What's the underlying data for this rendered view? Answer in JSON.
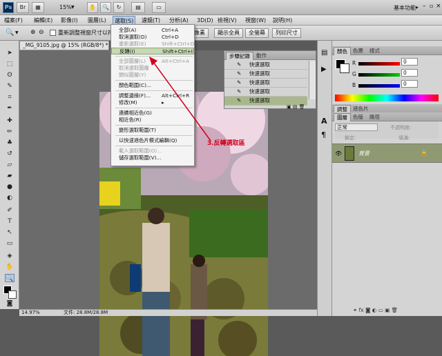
{
  "app": {
    "logo": "Ps",
    "zoom": "15%",
    "workspace_label": "基本功能"
  },
  "menubar": [
    "檔案(F)",
    "編輯(E)",
    "影像(I)",
    "圖層(L)",
    "選取(S)",
    "濾鏡(T)",
    "分析(A)",
    "3D(D)",
    "檢視(V)",
    "視窗(W)",
    "說明(H)"
  ],
  "options": {
    "resize_checkbox": "重新調整視窗尺寸以符",
    "btn_fit": "像素",
    "btn_fill": "顯示全頁",
    "btn_full": "全螢幕",
    "btn_print": "列印尺寸"
  },
  "document": {
    "tab_title": "_MG_9105.jpg @ 15% (RGB/8*) *",
    "status_zoom": "14.97%",
    "status_file": "文件: 28.8M/28.8M"
  },
  "history": {
    "tabs": [
      "步驟記錄",
      "動作"
    ],
    "items": [
      "快速選取",
      "快速選取",
      "快速選取",
      "快速選取",
      "快速選取"
    ]
  },
  "color_panel": {
    "tabs": [
      "顏色",
      "色票",
      "樣式"
    ],
    "channels": [
      {
        "label": "R",
        "value": "0",
        "color": "#ff0000"
      },
      {
        "label": "G",
        "value": "0",
        "color": "#00cc00"
      },
      {
        "label": "B",
        "value": "0",
        "color": "#0000ff"
      }
    ]
  },
  "adjust_panel": {
    "tabs": [
      "調整",
      "遮色片"
    ]
  },
  "layers_panel": {
    "tabs": [
      "圖層",
      "色版",
      "路徑"
    ],
    "blend_mode": "正常",
    "opacity_label": "不透明度:",
    "fill_label": "填滿:",
    "lock_label": "鎖定:",
    "layer_name": "背景"
  },
  "select_menu": {
    "items": [
      {
        "label": "全部(A)",
        "shortcut": "Ctrl+A",
        "state": "normal"
      },
      {
        "label": "取消選取(D)",
        "shortcut": "Ctrl+D",
        "state": "normal"
      },
      {
        "label": "重新選取(E)",
        "shortcut": "Shift+Ctrl+D",
        "state": "disabled"
      },
      {
        "label": "反轉(I)",
        "shortcut": "Shift+Ctrl+I",
        "state": "highlight"
      },
      {
        "sep": true
      },
      {
        "label": "全部圖層(L)",
        "shortcut": "Alt+Ctrl+A",
        "state": "disabled"
      },
      {
        "label": "取消選取圖層",
        "shortcut": "",
        "state": "disabled"
      },
      {
        "label": "類似圖層(Y)",
        "shortcut": "",
        "state": "disabled"
      },
      {
        "sep": true
      },
      {
        "label": "顏色範圍(C)...",
        "shortcut": "",
        "state": "normal"
      },
      {
        "sep": true
      },
      {
        "label": "調整邊緣(F)...",
        "shortcut": "Alt+Ctrl+R",
        "state": "normal"
      },
      {
        "label": "修改(M)",
        "shortcut": "▸",
        "state": "normal"
      },
      {
        "sep": true
      },
      {
        "label": "連續相近色(G)",
        "shortcut": "",
        "state": "normal"
      },
      {
        "label": "相近色(R)",
        "shortcut": "",
        "state": "normal"
      },
      {
        "sep": true
      },
      {
        "label": "變形選取範圍(T)",
        "shortcut": "",
        "state": "normal"
      },
      {
        "sep": true
      },
      {
        "label": "以快速遮色片模式編輯(Q)",
        "shortcut": "",
        "state": "normal"
      },
      {
        "sep": true
      },
      {
        "label": "載入選取範圍(O)...",
        "shortcut": "",
        "state": "disabled"
      },
      {
        "label": "儲存選取範圍(V)...",
        "shortcut": "",
        "state": "normal"
      }
    ]
  },
  "annotation": "3.反轉選取區"
}
